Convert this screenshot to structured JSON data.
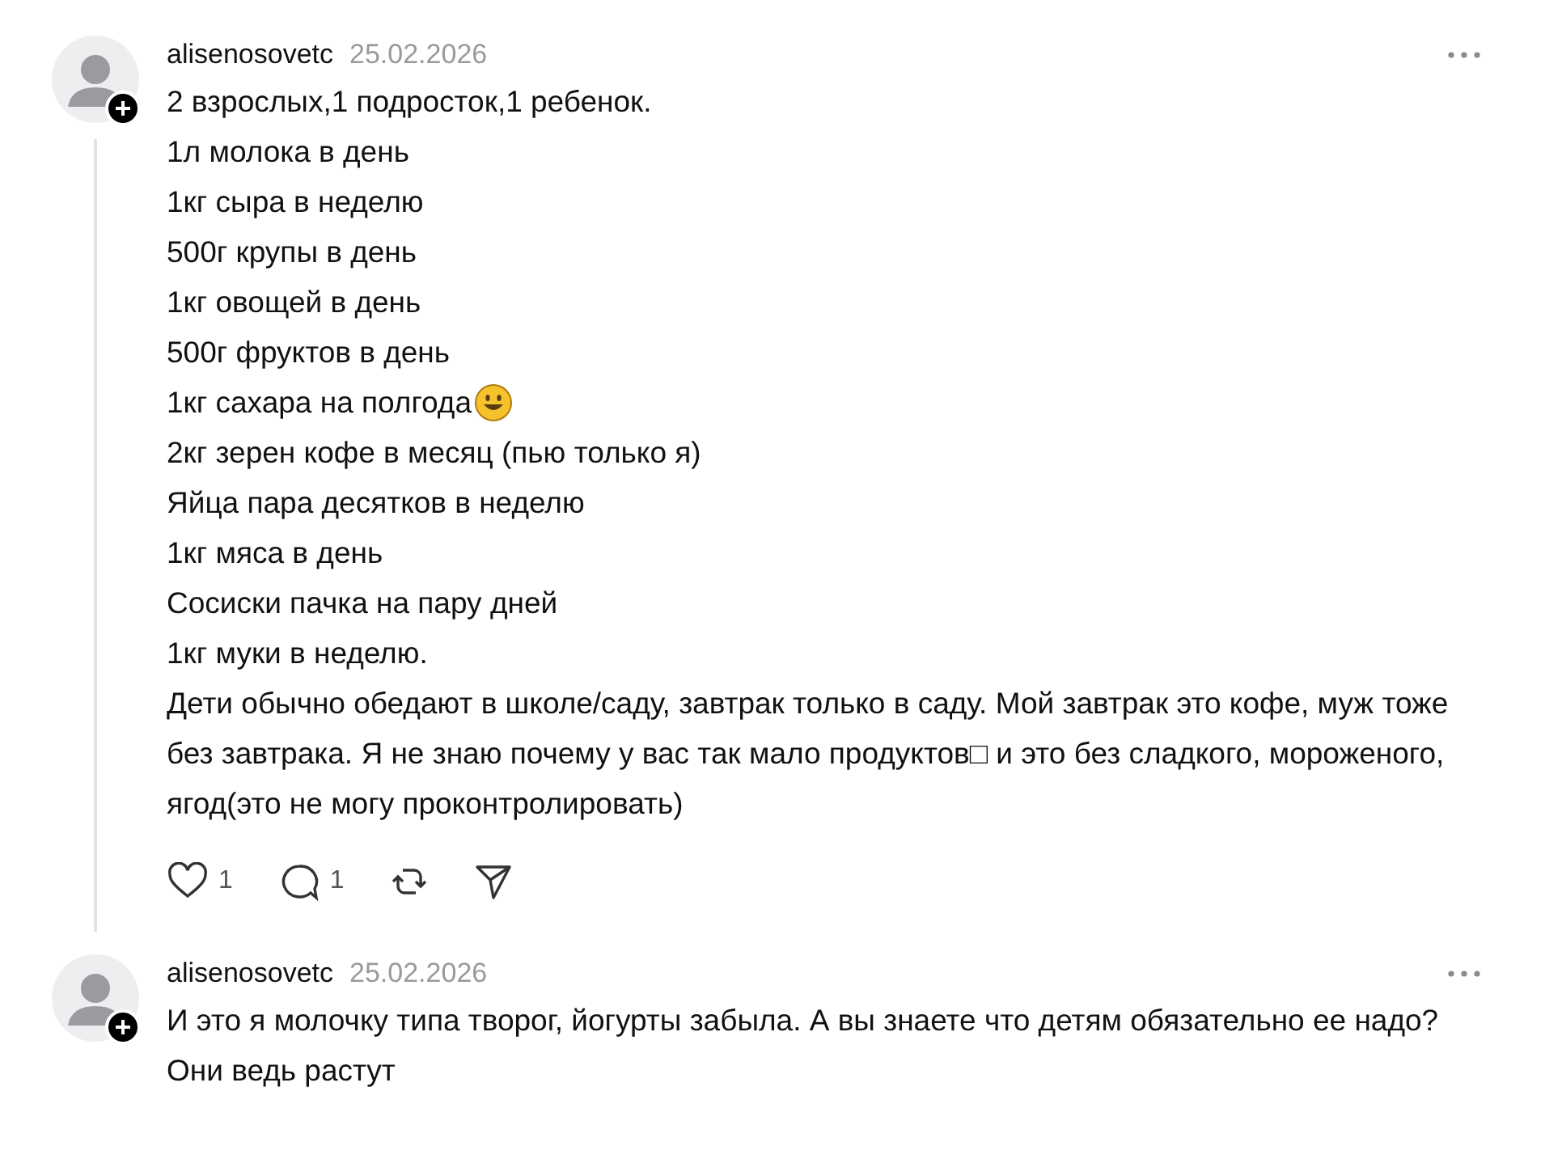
{
  "comments": [
    {
      "username": "alisenosovetc",
      "date": "25.02.2026",
      "thread": true,
      "lines": [
        {
          "text": "2 взрослых,1 подросток,1 ребенок.",
          "emoji": false
        },
        {
          "text": "1л молока в день",
          "emoji": false
        },
        {
          "text": "1кг сыра в неделю",
          "emoji": false
        },
        {
          "text": "500г крупы в день",
          "emoji": false
        },
        {
          "text": "1кг овощей в день",
          "emoji": false
        },
        {
          "text": "500г фруктов в день",
          "emoji": false
        },
        {
          "text": "1кг сахара на полгода",
          "emoji": true
        },
        {
          "text": "2кг зерен кофе в месяц (пью только я)",
          "emoji": false
        },
        {
          "text": "Яйца пара десятков в неделю",
          "emoji": false
        },
        {
          "text": "1кг мяса в день",
          "emoji": false
        },
        {
          "text": "Сосиски пачка на пару дней",
          "emoji": false
        },
        {
          "text": "1кг муки в неделю.",
          "emoji": false
        },
        {
          "text": "Дети обычно обедают в школе/саду, завтрак только в саду. Мой завтрак это кофе, муж тоже без завтрака. Я не знаю почему у вас так мало продуктов□ и это без сладкого, мороженого, ягод(это не могу проконтролировать)",
          "emoji": false
        }
      ],
      "actions": {
        "likes": "1",
        "replies": "1"
      }
    },
    {
      "username": "alisenosovetc",
      "date": "25.02.2026",
      "thread": false,
      "lines": [
        {
          "text": "И это я молочку типа творог, йогурты забыла. А вы знаете что детям обязательно ее надо? Они ведь растут",
          "emoji": false
        }
      ]
    }
  ]
}
